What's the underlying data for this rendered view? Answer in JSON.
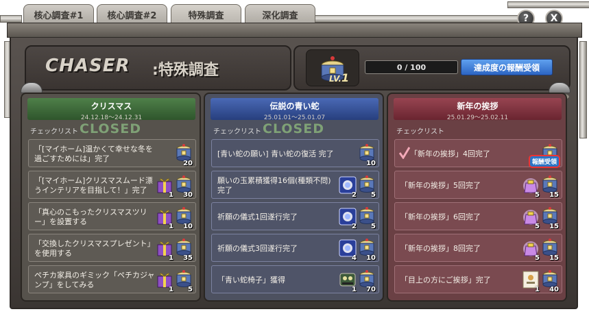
{
  "tabs": [
    "核心調査#1",
    "核心調査#2",
    "特殊調査",
    "深化調査"
  ],
  "active_tab": "特殊調査",
  "top_buttons": {
    "help": "?",
    "close": "X"
  },
  "header": {
    "title_en": "CHASER",
    "title_sep": ":",
    "title_jp": "特殊調査"
  },
  "level": {
    "label": "LV.",
    "value": "1"
  },
  "progress": {
    "text": "0 / 100",
    "current": 0,
    "max": 100
  },
  "claim_button": "達成度の報酬受領",
  "checklist_label": "チェックリスト",
  "columns": [
    {
      "title": "クリスマス",
      "dates": "24.12.18～24.12.31",
      "status": "CLOSED",
      "header_color": "#3f6a3c",
      "items": [
        {
          "text": "「[マイホーム]温かくて幸せな冬を過ごすためには」完了",
          "rewards": [
            {
              "icon": "chest-icon",
              "count": "20"
            }
          ]
        },
        {
          "text": "「[マイホーム]クリスマスムード漂うインテリアを目指して！」完了",
          "rewards": [
            {
              "icon": "gift-box-icon",
              "count": "1"
            },
            {
              "icon": "chest-icon",
              "count": "30"
            }
          ]
        },
        {
          "text": "「真心のこもったクリスマスツリー」を設置する",
          "rewards": [
            {
              "icon": "gift-box-icon",
              "count": "1"
            },
            {
              "icon": "chest-icon",
              "count": "10"
            }
          ]
        },
        {
          "text": "「交換したクリスマスプレゼント」を使用する",
          "rewards": [
            {
              "icon": "gift-box-icon",
              "count": "1"
            },
            {
              "icon": "chest-icon",
              "count": "35"
            }
          ]
        },
        {
          "text": "ペチカ家具のギミック「ペチカジャンプ」をしてみる",
          "rewards": [
            {
              "icon": "gift-box-icon",
              "count": "1"
            },
            {
              "icon": "chest-icon",
              "count": "5"
            }
          ]
        }
      ]
    },
    {
      "title": "伝説の青い蛇",
      "dates": "25.01.01～25.01.07",
      "status": "CLOSED",
      "header_color": "#2f4c8a",
      "items": [
        {
          "text": "[青い蛇の願い] 青い蛇の復活 完了",
          "rewards": [
            {
              "icon": "chest-icon",
              "count": "10"
            }
          ]
        },
        {
          "text": "願いの玉累積獲得16個(種類不問) 完了",
          "rewards": [
            {
              "icon": "wish-orb-icon",
              "count": "2"
            },
            {
              "icon": "chest-icon",
              "count": "5"
            }
          ]
        },
        {
          "text": "祈願の儀式1回遂行完了",
          "rewards": [
            {
              "icon": "wish-orb-icon",
              "count": "2"
            },
            {
              "icon": "chest-icon",
              "count": "5"
            }
          ]
        },
        {
          "text": "祈願の儀式3回遂行完了",
          "rewards": [
            {
              "icon": "wish-orb-icon",
              "count": "4"
            },
            {
              "icon": "chest-icon",
              "count": "10"
            }
          ]
        },
        {
          "text": "「青い蛇椅子」獲得",
          "rewards": [
            {
              "icon": "chair-icon",
              "count": "1"
            },
            {
              "icon": "chest-icon",
              "count": "70"
            }
          ]
        }
      ]
    },
    {
      "title": "新年の挨拶",
      "dates": "25.01.29～25.02.11",
      "status": "",
      "header_color": "#7a2d36",
      "items": [
        {
          "text": "「新年の挨拶」4回完了",
          "checked": true,
          "claim": "報酬受領",
          "rewards": [
            {
              "icon": "chest-icon",
              "count": ""
            }
          ]
        },
        {
          "text": "「新年の挨拶」5回完了",
          "rewards": [
            {
              "icon": "lucky-bag-icon",
              "count": "5"
            },
            {
              "icon": "chest-icon",
              "count": "15"
            }
          ]
        },
        {
          "text": "「新年の挨拶」6回完了",
          "rewards": [
            {
              "icon": "lucky-bag-icon",
              "count": "5"
            },
            {
              "icon": "chest-icon",
              "count": "15"
            }
          ]
        },
        {
          "text": "「新年の挨拶」8回完了",
          "rewards": [
            {
              "icon": "lucky-bag-icon",
              "count": "5"
            },
            {
              "icon": "chest-icon",
              "count": "15"
            }
          ]
        },
        {
          "text": "「目上の方にご挨拶」完了",
          "rewards": [
            {
              "icon": "greeting-card-icon",
              "count": "1"
            },
            {
              "icon": "chest-icon",
              "count": "40"
            }
          ]
        }
      ]
    }
  ]
}
